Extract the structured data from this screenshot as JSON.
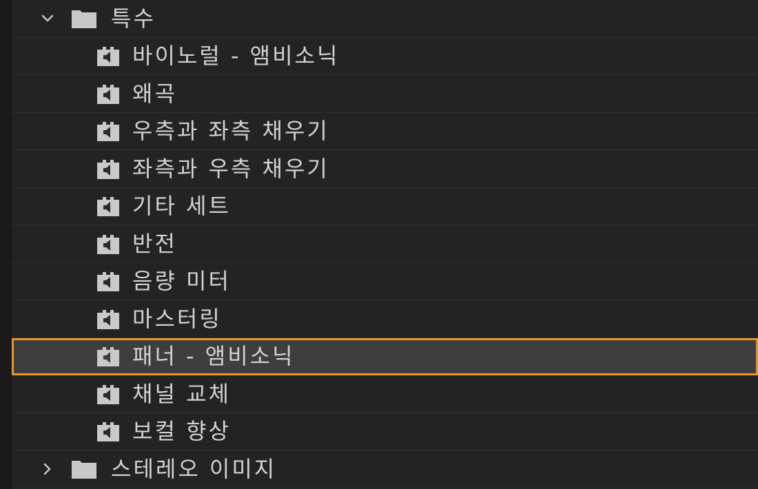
{
  "colors": {
    "background": "#1f1f1f",
    "row": "#232323",
    "row_divider": "#313131",
    "selected_row": "#3e3e3e",
    "selection_outline": "#e8962b",
    "text": "#d2d2d2",
    "icon": "#c9c9c9"
  },
  "tree": {
    "special_folder": {
      "label": "특수",
      "expanded": true,
      "icon": "folder-icon",
      "chevron": "chevron-down-icon",
      "items": [
        {
          "label": "바이노럴 - 앰비소닉",
          "icon": "audio-effect-icon",
          "selected": false
        },
        {
          "label": "왜곡",
          "icon": "audio-effect-icon",
          "selected": false
        },
        {
          "label": "우측과 좌측 채우기",
          "icon": "audio-effect-icon",
          "selected": false
        },
        {
          "label": "좌측과 우측 채우기",
          "icon": "audio-effect-icon",
          "selected": false
        },
        {
          "label": "기타 세트",
          "icon": "audio-effect-icon",
          "selected": false
        },
        {
          "label": "반전",
          "icon": "audio-effect-icon",
          "selected": false
        },
        {
          "label": "음량 미터",
          "icon": "audio-effect-icon",
          "selected": false
        },
        {
          "label": "마스터링",
          "icon": "audio-effect-icon",
          "selected": false
        },
        {
          "label": "패너 - 앰비소닉",
          "icon": "audio-effect-icon",
          "selected": true
        },
        {
          "label": "채널 교체",
          "icon": "audio-effect-icon",
          "selected": false
        },
        {
          "label": "보컬 향상",
          "icon": "audio-effect-icon",
          "selected": false
        }
      ]
    },
    "stereo_image_folder": {
      "label": "스테레오 이미지",
      "expanded": false,
      "icon": "folder-icon",
      "chevron": "chevron-right-icon"
    }
  }
}
